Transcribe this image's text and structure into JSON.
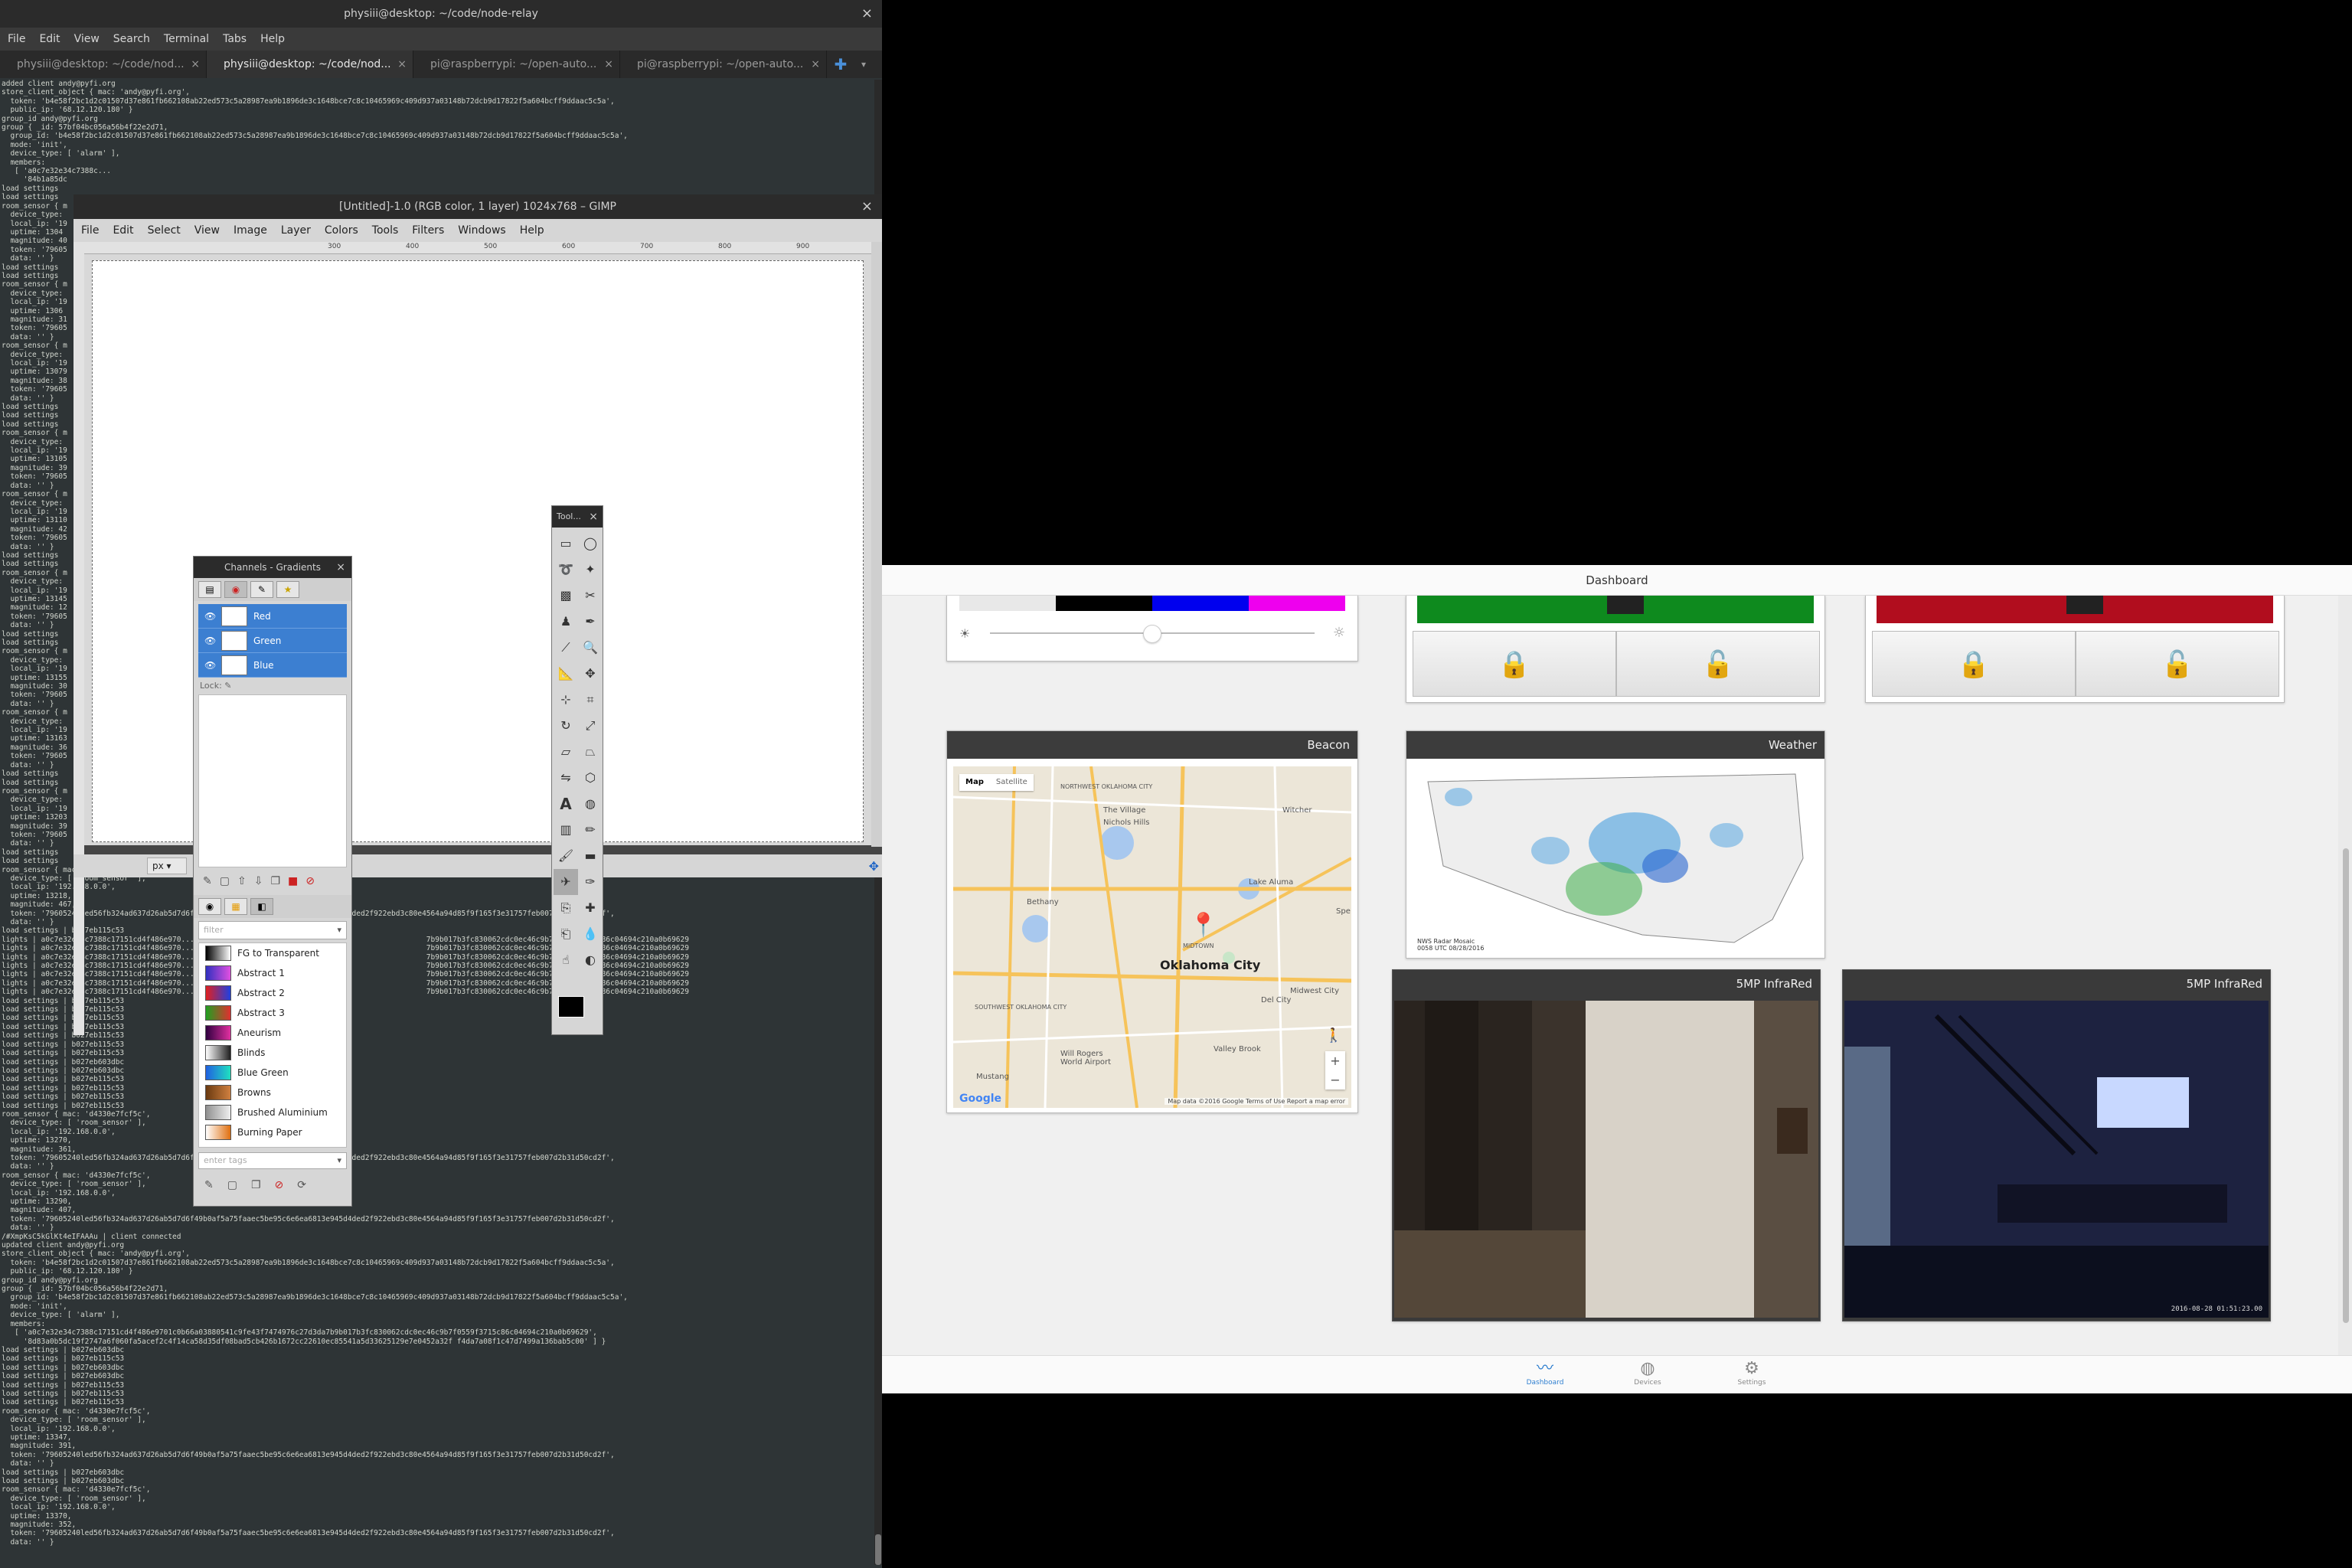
{
  "terminal": {
    "title": "physiii@desktop: ~/code/node-relay",
    "menu": [
      "File",
      "Edit",
      "View",
      "Search",
      "Terminal",
      "Tabs",
      "Help"
    ],
    "tabs": [
      {
        "label": "physiii@desktop: ~/code/nod..."
      },
      {
        "label": "physiii@desktop: ~/code/nod..."
      },
      {
        "label": "pi@raspberrypi: ~/open-auto..."
      },
      {
        "label": "pi@raspberrypi: ~/open-auto..."
      }
    ],
    "output_top": "added client andy@pyfi.org\nstore_client_object { mac: 'andy@pyfi.org',\n  token: 'b4e58f2bc1d2c01507d37e861fb662108ab22ed573c5a28987ea9b1896de3c1648bce7c8c10465969c409d937a03148b72dcb9d17822f5a604bcff9ddaac5c5a',\n  public_ip: '68.12.120.180' }\ngroup_id andy@pyfi.org\ngroup { _id: 57bf04bc056a56b4f22e2d71,\n  group_id: 'b4e58f2bc1d2c01507d37e861fb662108ab22ed573c5a28987ea9b1896de3c1648bce7c8c10465969c409d937a03148b72dcb9d17822f5a604bcff9ddaac5c5a',\n  mode: 'init',\n  device_type: [ 'alarm' ],\n  members:\n   [ 'a0c7e32e34c7388c...\n     '84b1a85dc\nload settings\nload settings\nroom_sensor { m\n  device_type:\n  local_ip: '19\n  uptime: 1304\n  magnitude: 40\n  token: '79605\n  data: '' }\nload settings\nload settings\nroom_sensor { m\n  device_type:\n  local_ip: '19\n  uptime: 1306\n  magnitude: 31\n  token: '79605\n  data: '' }\nroom_sensor { m\n  device_type:\n  local_ip: '19\n  uptime: 13079\n  magnitude: 38\n  token: '79605\n  data: '' }\nload settings\nload settings\nload settings\nroom_sensor { m\n  device_type:\n  local_ip: '19\n  uptime: 13105\n  magnitude: 39\n  token: '79605\n  data: '' }\nroom_sensor { m\n  device_type:\n  local_ip: '19\n  uptime: 13110\n  magnitude: 42\n  token: '79605\n  data: '' }\nload settings\nload settings\nroom_sensor { m\n  device_type:\n  local_ip: '19\n  uptime: 13145\n  magnitude: 12\n  token: '79605\n  data: '' }\nload settings\nload settings\nroom_sensor { m\n  device_type:\n  local_ip: '19\n  uptime: 13155\n  magnitude: 30\n  token: '79605\n  data: '' }\nroom_sensor { m\n  device_type:\n  local_ip: '19\n  uptime: 13163\n  magnitude: 36\n  token: '79605\n  data: '' }\nload settings\nload settings\nroom_sensor { m\n  device_type:\n  local_ip: '19\n  uptime: 13203\n  magnitude: 39\n  token: '79605\n  data: '' }\nload settings\nload settings\nroom_sensor { mac: 'd4330e7fcf5c',\n  device_type: [ 'room_sensor' ],\n  local_ip: '192.168.0.0',\n  uptime: 13218,\n  magnitude: 467,\n  token: '79605240led56fb324ad637d26ab5d7d6f49b0af5a75faaec5be95c6e6ea6813e945d4ded2f922ebd3c80e4564a94d85f9f165f3e31757feb007d2b31d50cd2f',\n  data: '' }\nload settings | b027eb115c53\nlights | a0c7e32e34c7388c17151cd4f486e970...                                                     7b9b017b3fc830062cdc0ec46c9b7f0559f3715c86c04694c210a0b69629\nlights | a0c7e32e34c7388c17151cd4f486e970...                                                     7b9b017b3fc830062cdc0ec46c9b7f0559f3715c86c04694c210a0b69629\nlights | a0c7e32e34c7388c17151cd4f486e970...                                                     7b9b017b3fc830062cdc0ec46c9b7f0559f3715c86c04694c210a0b69629\nlights | a0c7e32e34c7388c17151cd4f486e970...                                                     7b9b017b3fc830062cdc0ec46c9b7f0559f3715c86c04694c210a0b69629\nlights | a0c7e32e34c7388c17151cd4f486e970...                                                     7b9b017b3fc830062cdc0ec46c9b7f0559f3715c86c04694c210a0b69629\nlights | a0c7e32e34c7388c17151cd4f486e970...                                                     7b9b017b3fc830062cdc0ec46c9b7f0559f3715c86c04694c210a0b69629\nlights | a0c7e32e34c7388c17151cd4f486e970...                                                     7b9b017b3fc830062cdc0ec46c9b7f0559f3715c86c04694c210a0b69629\nload settings | b027eb115c53\nload settings | b027eb115c53\nload settings | b027eb115c53\nload settings | b027eb115c53\nload settings | b027eb115c53\nload settings | b027eb115c53\nload settings | b027eb115c53\nload settings | b027eb603dbc\nload settings | b027eb603dbc\nload settings | b027eb115c53\nload settings | b027eb115c53\nload settings | b027eb115c53\nload settings | b027eb115c53\nroom_sensor { mac: 'd4330e7fcf5c',\n  device_type: [ 'room_sensor' ],\n  local_ip: '192.168.0.0',\n  uptime: 13270,\n  magnitude: 361,\n  token: '79605240led56fb324ad637d26ab5d7d6f49b0af5a75faaec5be95c6e6ea6813e945d4ded2f922ebd3c80e4564a94d85f9f165f3e31757feb007d2b31d50cd2f',\n  data: '' }\nroom_sensor { mac: 'd4330e7fcf5c',\n  device_type: [ 'room_sensor' ],\n  local_ip: '192.168.0.0',\n  uptime: 13290,\n  magnitude: 407,\n  token: '79605240led56fb324ad637d26ab5d7d6f49b0af5a75faaec5be95c6e6ea6813e945d4ded2f922ebd3c80e4564a94d85f9f165f3e31757feb007d2b31d50cd2f',\n  data: '' }\n/#XmpKsC5kGlKt4eIFAAAu | client connected\nupdated client andy@pyfi.org\nstore_client_object { mac: 'andy@pyfi.org',\n  token: 'b4e58f2bc1d2c01507d37e861fb662108ab22ed573c5a28987ea9b1896de3c1648bce7c8c10465969c409d937a03148b72dcb9d17822f5a604bcff9ddaac5c5a',\n  public_ip: '68.12.120.180' }\ngroup_id andy@pyfi.org\ngroup { _id: 57bf04bc056a56b4f22e2d71,\n  group_id: 'b4e58f2bc1d2c01507d37e861fb662108ab22ed573c5a28987ea9b1896de3c1648bce7c8c10465969c409d937a03148b72dcb9d17822f5a604bcff9ddaac5c5a',\n  mode: 'init',\n  device_type: [ 'alarm' ],\n  members:\n   [ 'a0c7e32e34c7388c17151cd4f486e9701c0b66a03880541c9fe43f7474976c27d3da7b9b017b3fc830062cdc0ec46c9b7f0559f3715c86c04694c210a0b69629',\n     '8d83a0b5dc19f2747a6f060fa5acef2c4f14ca58d35df08bad5cb426b1672cc22610ec85541a5d33625129e7e0452a32f f4da7a08f1c47d7499a136bab5c00' ] }\nload settings | b027eb603dbc\nload settings | b027eb115c53\nload settings | b027eb603dbc\nload settings | b027eb603dbc\nload settings | b027eb115c53\nload settings | b027eb115c53\nload settings | b027eb115c53\nroom_sensor { mac: 'd4330e7fcf5c',\n  device_type: [ 'room_sensor' ],\n  local_ip: '192.168.0.0',\n  uptime: 13347,\n  magnitude: 391,\n  token: '79605240led56fb324ad637d26ab5d7d6f49b0af5a75faaec5be95c6e6ea6813e945d4ded2f922ebd3c80e4564a94d85f9f165f3e31757feb007d2b31d50cd2f',\n  data: '' }\nload settings | b027eb603dbc\nload settings | b027eb603dbc\nroom_sensor { mac: 'd4330e7fcf5c',\n  device_type: [ 'room_sensor' ],\n  local_ip: '192.168.0.0',\n  uptime: 13370,\n  magnitude: 352,\n  token: '79605240led56fb324ad637d26ab5d7d6f49b0af5a75faaec5be95c6e6ea6813e945d4ded2f922ebd3c80e4564a94d85f9f165f3e31757feb007d2b31d50cd2f',\n  data: '' }"
  },
  "gimp": {
    "title": "[Untitled]-1.0 (RGB color, 1 layer) 1024x768 – GIMP",
    "menu": [
      "File",
      "Edit",
      "Select",
      "View",
      "Image",
      "Layer",
      "Colors",
      "Tools",
      "Filters",
      "Windows",
      "Help"
    ],
    "ruler_ticks": [
      "300",
      "400",
      "500",
      "600",
      "700",
      "800",
      "900"
    ],
    "unit": "px",
    "dock": {
      "title": "Channels - Gradients",
      "channels": [
        "Red",
        "Green",
        "Blue"
      ],
      "lock_label": "Lock:",
      "filter_placeholder": "filter",
      "tags_placeholder": "enter tags",
      "gradients": [
        {
          "name": "FG to Transparent",
          "colors": [
            "#000000",
            "#ffffff"
          ]
        },
        {
          "name": "Abstract 1",
          "colors": [
            "#3030c0",
            "#e050e0"
          ]
        },
        {
          "name": "Abstract 2",
          "colors": [
            "#e02020",
            "#2040e0"
          ]
        },
        {
          "name": "Abstract 3",
          "colors": [
            "#20a020",
            "#e03030"
          ]
        },
        {
          "name": "Aneurism",
          "colors": [
            "#300040",
            "#e030a0"
          ]
        },
        {
          "name": "Blinds",
          "colors": [
            "#ffffff",
            "#202020"
          ]
        },
        {
          "name": "Blue Green",
          "colors": [
            "#2060e0",
            "#20e0c0"
          ]
        },
        {
          "name": "Browns",
          "colors": [
            "#6a3a10",
            "#d08040"
          ]
        },
        {
          "name": "Brushed Aluminium",
          "colors": [
            "#909090",
            "#f0f0f0"
          ]
        },
        {
          "name": "Burning Paper",
          "colors": [
            "#ffffff",
            "#e07010"
          ]
        }
      ]
    },
    "toolbox": {
      "title": "Tool...",
      "fg_color": "#000000"
    }
  },
  "app": {
    "header": "Dashboard",
    "light": {
      "swatches": [
        "#e8e8e8",
        "#000000",
        "#0000ee",
        "#ee00ee"
      ],
      "brightness": 0.5
    },
    "lock1": {
      "status_color": "#0e8a1e"
    },
    "lock2": {
      "status_color": "#b10d1e"
    },
    "beacon": {
      "title": "Beacon",
      "map_toggle": [
        "Map",
        "Satellite"
      ],
      "city": "Oklahoma City",
      "labels": [
        "The Village",
        "Nichols Hills",
        "Bethany",
        "Lake Aluma",
        "Midwest City",
        "Del City",
        "Will Rogers World Airport",
        "Valley Brook",
        "Mustang",
        "Witcher",
        "NORTHWEST OKLAHOMA CITY",
        "SOUTHWEST OKLAHOMA CITY",
        "MIDTOWN",
        "Spe"
      ],
      "google": "Google",
      "footer": "Map data ©2016 Google   Terms of Use   Report a map error"
    },
    "weather": {
      "title": "Weather",
      "caption": "NWS Radar Mosaic\n0058 UTC 08/28/2016"
    },
    "camera1": {
      "title": "5MP InfraRed"
    },
    "camera2": {
      "title": "5MP InfraRed",
      "timestamp": "2016-08-28 01:51:23.00"
    },
    "tabs": [
      {
        "label": "Dashboard",
        "icon": "activity-icon",
        "active": true
      },
      {
        "label": "Devices",
        "icon": "globe-icon",
        "active": false
      },
      {
        "label": "Settings",
        "icon": "gear-icon",
        "active": false
      }
    ]
  }
}
